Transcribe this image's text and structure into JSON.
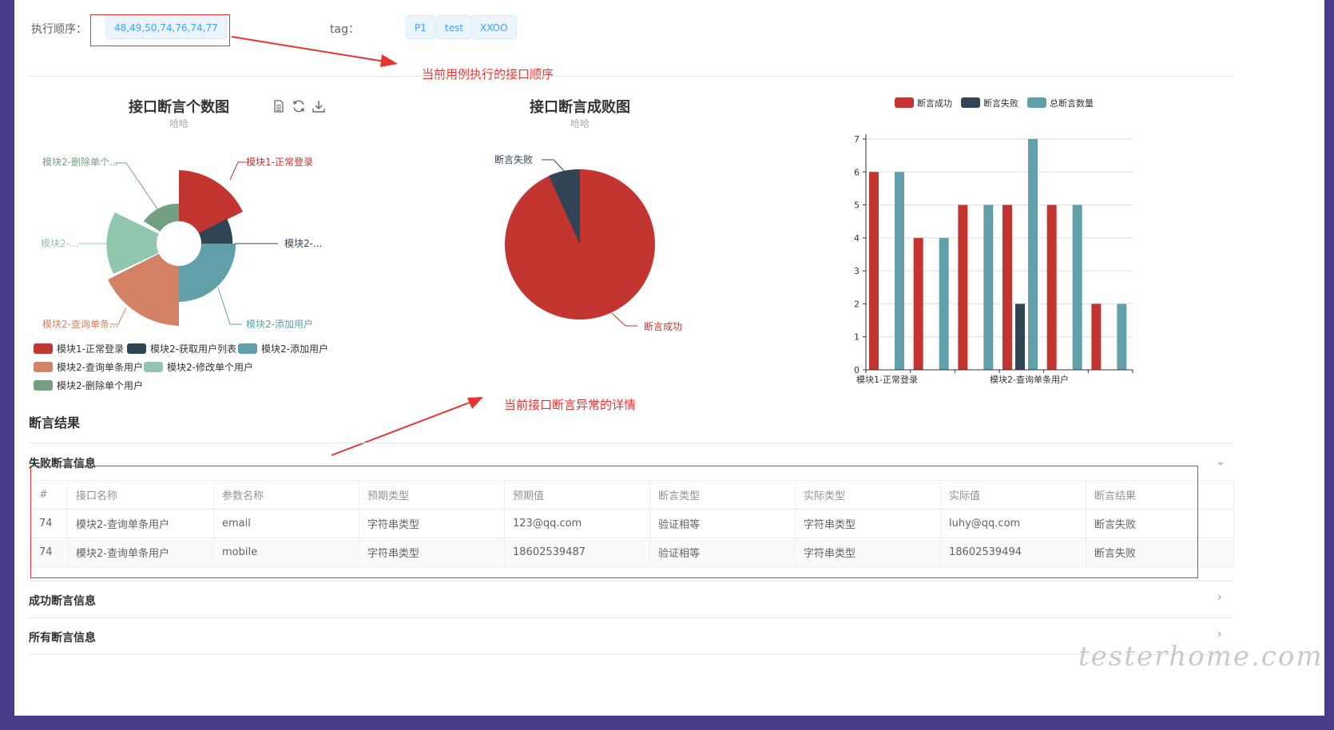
{
  "header": {
    "exec_order_label": "执行顺序：",
    "exec_order_value": "48,49,50,74,76,74,77",
    "tag_label": "tag：",
    "tags": [
      "P1",
      "test",
      "XXOO"
    ]
  },
  "annotations": {
    "exec_order_note": "当前用例执行的接口顺序",
    "assert_detail_note": "当前接口断言异常的详情"
  },
  "polar_chart": {
    "title": "接口断言个数图",
    "subtitle": "哈哈",
    "labels": [
      "模块1-正常登录",
      "模块2-...",
      "模块2-添加用户",
      "模块2-查询单条...",
      "模块2-...",
      "模块2-删除单个..."
    ],
    "legend": [
      "模块1-正常登录",
      "模块2-获取用户列表",
      "模块2-添加用户",
      "模块2-查询单条用户",
      "模块2-修改单个用户",
      "模块2-删除单个用户"
    ],
    "colors": [
      "#c23531",
      "#2f4554",
      "#61a0a8",
      "#d48265",
      "#91c7ae",
      "#749f83"
    ]
  },
  "pie_chart": {
    "title": "接口断言成败图",
    "subtitle": "哈哈",
    "fail_label": "断言失败",
    "success_label": "断言成功",
    "colors": {
      "success": "#c23531",
      "fail": "#2f4554"
    }
  },
  "chart_data": [
    {
      "type": "pie",
      "title": "接口断言个数图",
      "subtitle": "哈哈",
      "categories": [
        "模块1-正常登录",
        "模块2-获取用户列表",
        "模块2-添加用户",
        "模块2-查询单条用户",
        "模块2-修改单个用户",
        "模块2-删除单个用户"
      ],
      "values": [
        6,
        4,
        5,
        7,
        5,
        2
      ]
    },
    {
      "type": "pie",
      "title": "接口断言成败图",
      "subtitle": "哈哈",
      "categories": [
        "断言成功",
        "断言失败"
      ],
      "values": [
        22,
        2
      ]
    },
    {
      "type": "bar",
      "categories": [
        "模块1-正常登录",
        "模块2-获取用户列表",
        "模块2-添加用户",
        "模块2-查询单条用户",
        "模块2-修改单个用户",
        "模块2-删除单个用户"
      ],
      "tick_labels_shown": [
        "模块1-正常登录",
        "模块2-查询单条用户"
      ],
      "series": [
        {
          "name": "断言成功",
          "values": [
            6,
            4,
            5,
            5,
            5,
            2
          ],
          "color": "#c23531"
        },
        {
          "name": "断言失败",
          "values": [
            0,
            0,
            0,
            2,
            0,
            0
          ],
          "color": "#2f4554"
        },
        {
          "name": "总断言数量",
          "values": [
            6,
            4,
            5,
            7,
            5,
            2
          ],
          "color": "#61a0a8"
        }
      ],
      "ylim": [
        0,
        7
      ],
      "yticks": [
        0,
        1,
        2,
        3,
        4,
        5,
        6,
        7
      ],
      "legend_position": "top"
    }
  ],
  "result": {
    "section_title": "断言结果",
    "fail_panel_title": "失败断言信息",
    "success_panel_title": "成功断言信息",
    "all_panel_title": "所有断言信息",
    "columns": [
      "#",
      "接口名称",
      "参数名称",
      "预期类型",
      "预期值",
      "断言类型",
      "实际类型",
      "实际值",
      "断言结果"
    ],
    "rows": [
      [
        "74",
        "模块2-查询单条用户",
        "email",
        "字符串类型",
        "123@qq.com",
        "验证相等",
        "字符串类型",
        "luhy@qq.com",
        "断言失败"
      ],
      [
        "74",
        "模块2-查询单条用户",
        "mobile",
        "字符串类型",
        "18602539487",
        "验证相等",
        "字符串类型",
        "18602539494",
        "断言失败"
      ]
    ]
  },
  "watermark": "testerhome.com"
}
